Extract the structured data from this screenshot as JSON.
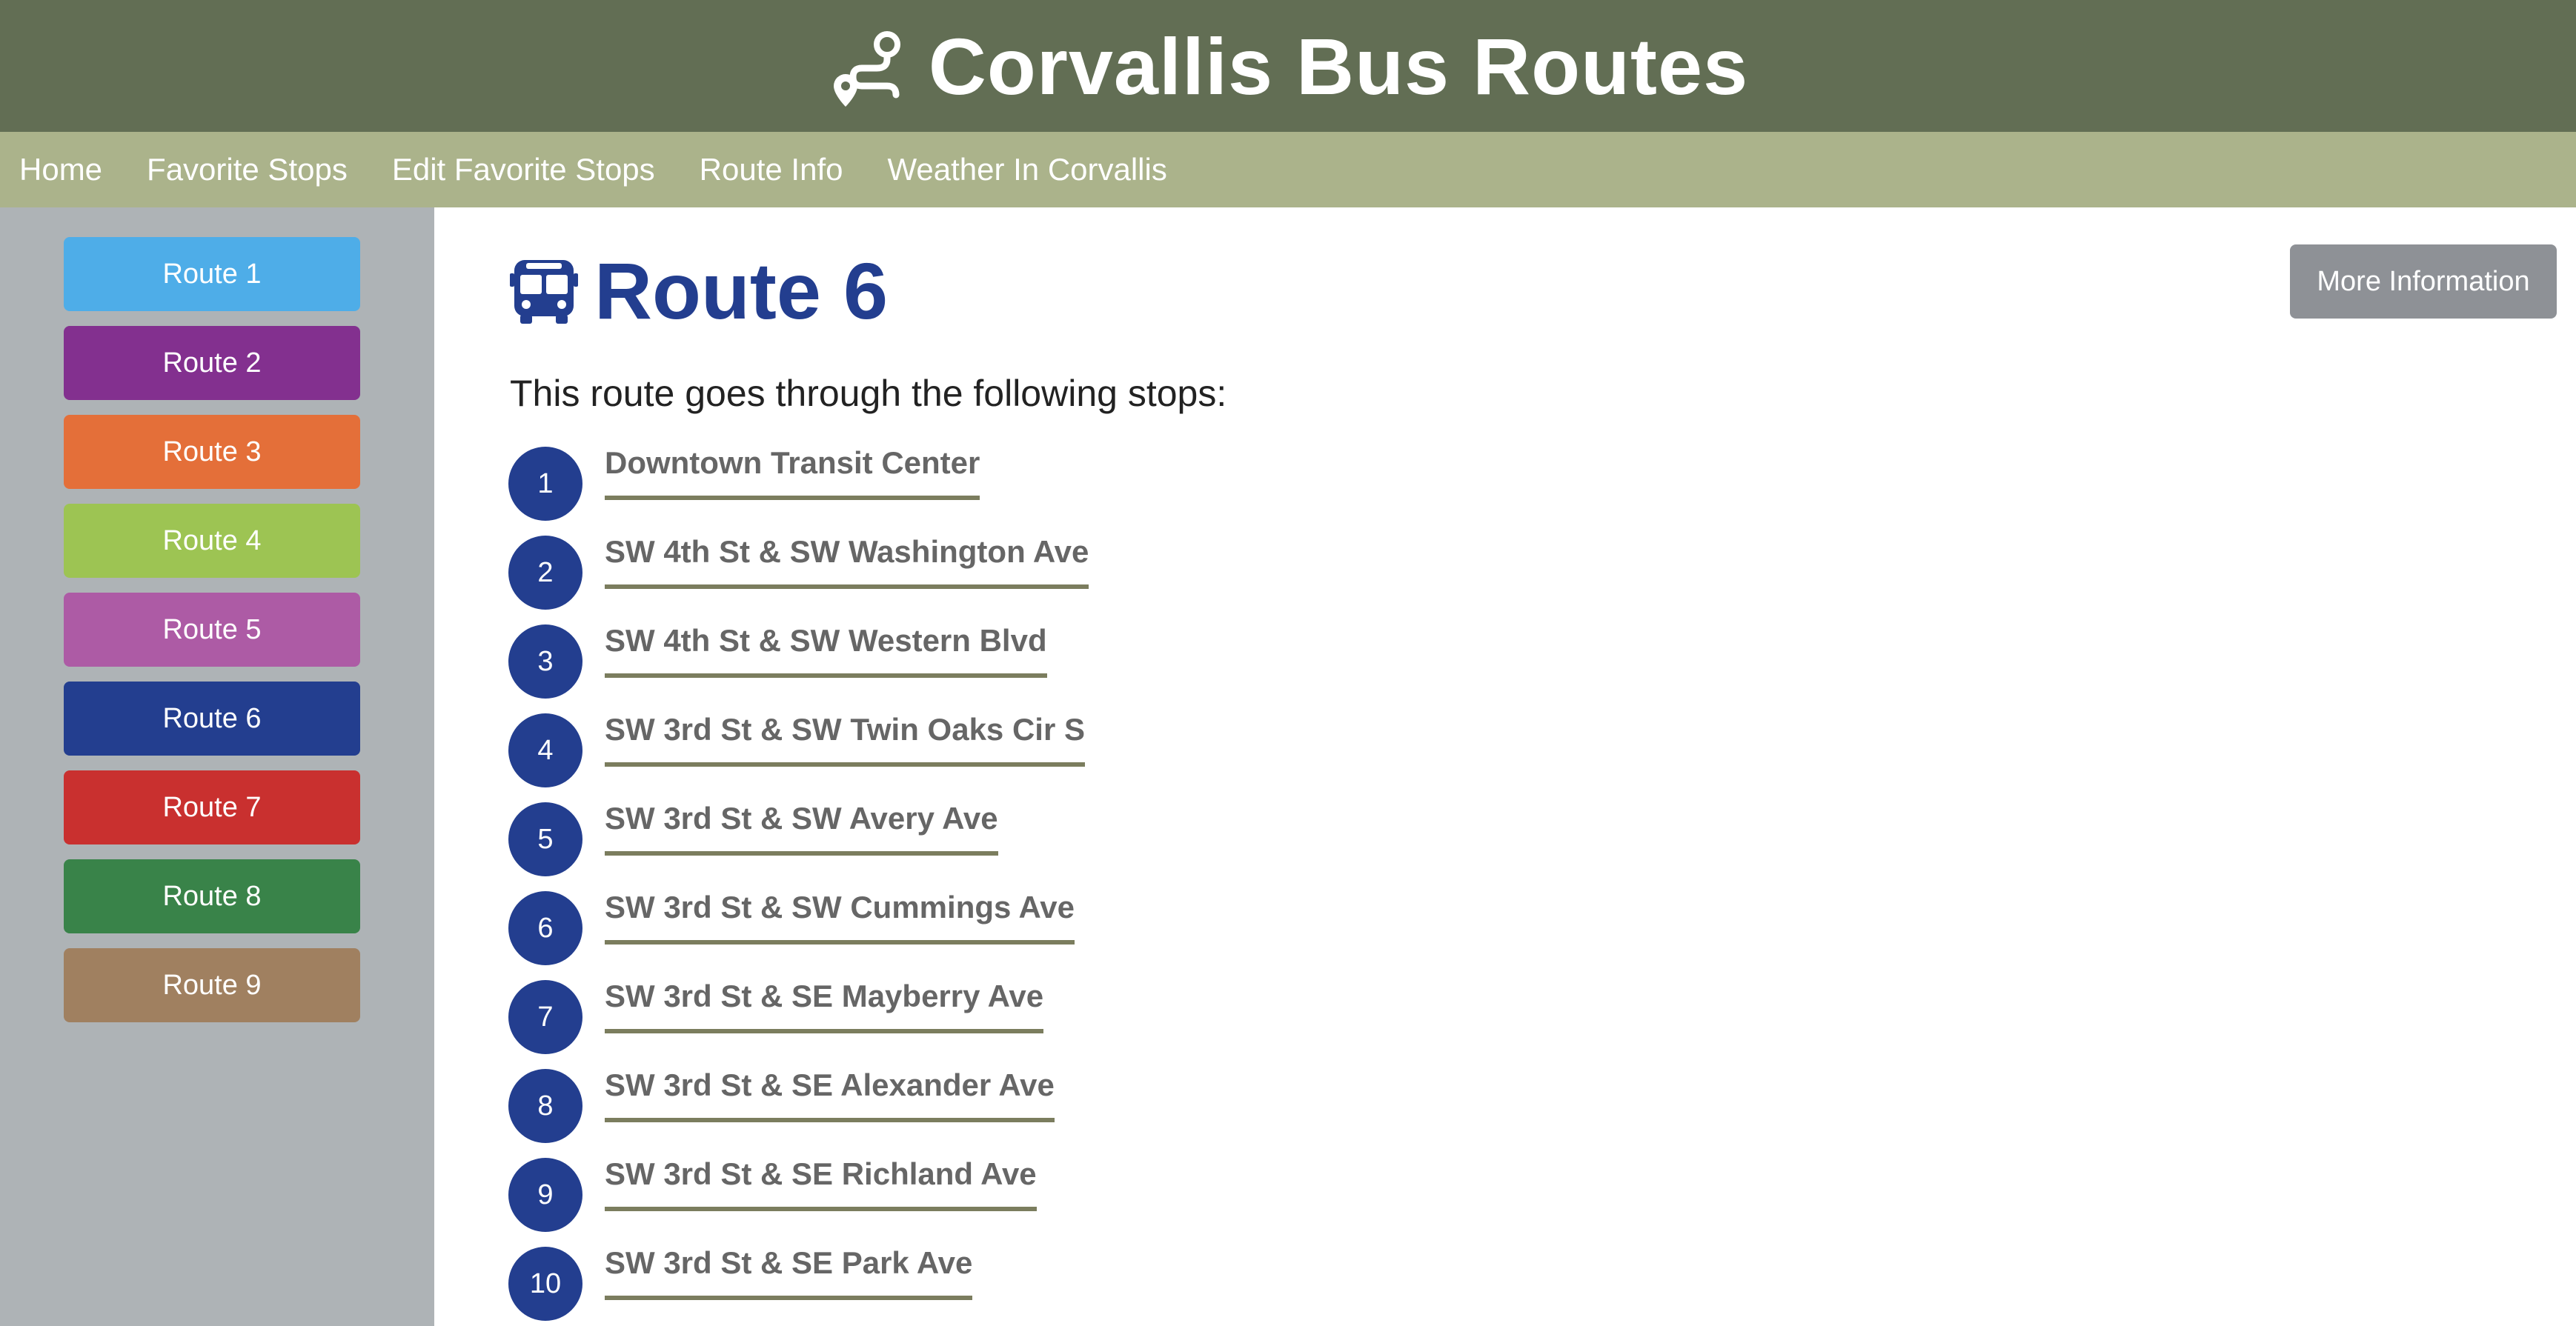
{
  "header": {
    "title": "Corvallis Bus Routes",
    "icon": "route-icon"
  },
  "nav": {
    "items": [
      {
        "label": "Home"
      },
      {
        "label": "Favorite Stops"
      },
      {
        "label": "Edit Favorite Stops"
      },
      {
        "label": "Route Info"
      },
      {
        "label": "Weather In Corvallis"
      }
    ]
  },
  "sidebar": {
    "routes": [
      {
        "label": "Route 1",
        "color": "#4eade8"
      },
      {
        "label": "Route 2",
        "color": "#83308f"
      },
      {
        "label": "Route 3",
        "color": "#e46f39"
      },
      {
        "label": "Route 4",
        "color": "#9dc453"
      },
      {
        "label": "Route 5",
        "color": "#ad5ba5"
      },
      {
        "label": "Route 6",
        "color": "#233e8f"
      },
      {
        "label": "Route 7",
        "color": "#c9302f"
      },
      {
        "label": "Route 8",
        "color": "#398349"
      },
      {
        "label": "Route 9",
        "color": "#a08060"
      }
    ]
  },
  "main": {
    "route_title": "Route 6",
    "title_icon": "bus-icon",
    "more_info_label": "More Information",
    "stops_heading": "This route goes through the following stops:",
    "stops": [
      {
        "num": "1",
        "name": "Downtown Transit Center"
      },
      {
        "num": "2",
        "name": "SW 4th St & SW Washington Ave"
      },
      {
        "num": "3",
        "name": "SW 4th St & SW Western Blvd"
      },
      {
        "num": "4",
        "name": "SW 3rd St & SW Twin Oaks Cir S"
      },
      {
        "num": "5",
        "name": "SW 3rd St & SW Avery Ave"
      },
      {
        "num": "6",
        "name": "SW 3rd St & SW Cummings Ave"
      },
      {
        "num": "7",
        "name": "SW 3rd St & SE Mayberry Ave"
      },
      {
        "num": "8",
        "name": "SW 3rd St & SE Alexander Ave"
      },
      {
        "num": "9",
        "name": "SW 3rd St & SE Richland Ave"
      },
      {
        "num": "10",
        "name": "SW 3rd St & SE Park Ave"
      }
    ]
  }
}
